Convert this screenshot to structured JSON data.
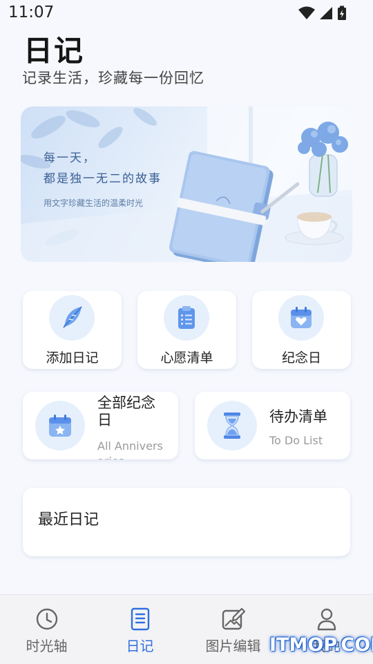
{
  "status_bar": {
    "time": "11:07"
  },
  "header": {
    "title": "日记",
    "subtitle": "记录生活，珍藏每一份回忆"
  },
  "banner": {
    "line1": "每一天，",
    "line2": "都是独一无二的故事",
    "caption": "用文字珍藏生活的温柔时光"
  },
  "quick_actions": [
    {
      "label": "添加日记",
      "icon": "feather-icon"
    },
    {
      "label": "心愿清单",
      "icon": "clipboard-icon"
    },
    {
      "label": "纪念日",
      "icon": "calendar-heart-icon"
    }
  ],
  "feature_cards": [
    {
      "title": "全部纪念日",
      "subtitle": "All Anniversaries",
      "icon": "calendar-star-icon"
    },
    {
      "title": "待办清单",
      "subtitle": "To Do List",
      "icon": "hourglass-icon"
    }
  ],
  "recent": {
    "title": "最近日记"
  },
  "bottom_nav": [
    {
      "label": "时光轴",
      "icon": "clock-icon",
      "active": false
    },
    {
      "label": "日记",
      "icon": "notebook-icon",
      "active": true
    },
    {
      "label": "图片编辑",
      "icon": "image-edit-icon",
      "active": false
    },
    {
      "label": "我的",
      "icon": "user-icon",
      "active": false
    }
  ],
  "watermark": "ITMOP.COM",
  "colors": {
    "accent": "#2f6fe0",
    "icon_blue": "#4f8fea",
    "background": "#f6f8fd"
  }
}
